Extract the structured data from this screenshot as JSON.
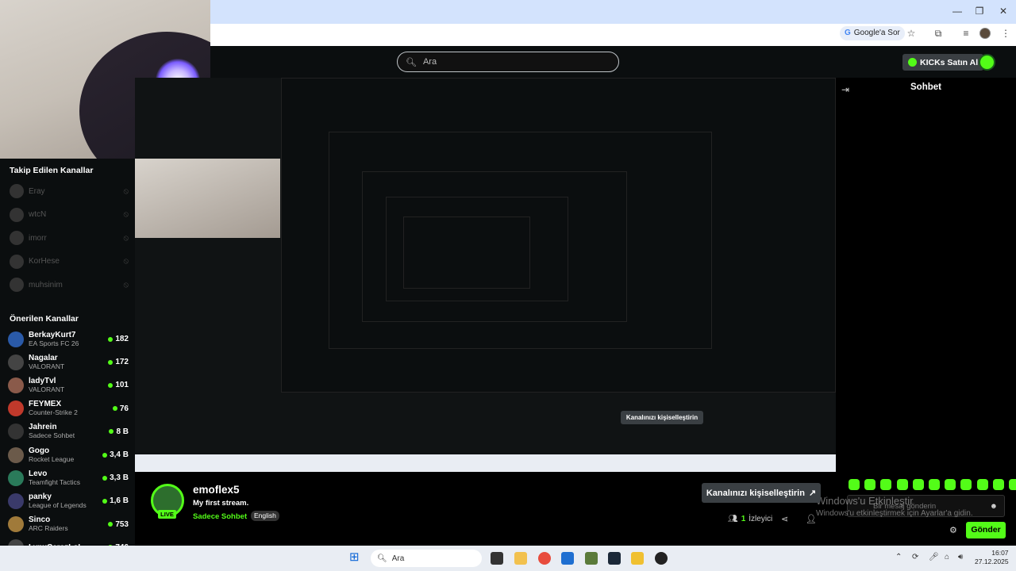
{
  "browser": {
    "ask_google_label": "Google'a Sor",
    "icons": [
      "minimize-icon",
      "restore-icon",
      "close-icon",
      "star-icon",
      "extensions-icon",
      "queue-icon",
      "menu-icon"
    ]
  },
  "kick": {
    "search_placeholder": "Ara",
    "buy_kicks_label": "KICKs Satın Al"
  },
  "sidebar": {
    "followed_title": "Takip Edilen Kanallar",
    "followed": [
      {
        "name": "Eray"
      },
      {
        "name": "wtcN"
      },
      {
        "name": "imorr"
      },
      {
        "name": "KorHese"
      },
      {
        "name": "muhsinim"
      }
    ],
    "recommended_title": "Önerilen Kanallar",
    "recommended": [
      {
        "name": "BerkayKurt7",
        "category": "EA Sports FC 26",
        "viewers": "182",
        "color": "#2a5aa8"
      },
      {
        "name": "Nagalar",
        "category": "VALORANT",
        "viewers": "172",
        "color": "#444"
      },
      {
        "name": "ladyTvl",
        "category": "VALORANT",
        "viewers": "101",
        "color": "#8a5a4a"
      },
      {
        "name": "FEYMEX",
        "category": "Counter-Strike 2",
        "viewers": "76",
        "color": "#c0392b"
      },
      {
        "name": "Jahrein",
        "category": "Sadece Sohbet",
        "viewers": "8 B",
        "color": "#333"
      },
      {
        "name": "Gogo",
        "category": "Rocket League",
        "viewers": "3,4 B",
        "color": "#6b5a4a"
      },
      {
        "name": "Levo",
        "category": "Teamfight Tactics",
        "viewers": "3,3 B",
        "color": "#2a7a5a"
      },
      {
        "name": "panky",
        "category": "League of Legends",
        "viewers": "1,6 B",
        "color": "#3a3a6a"
      },
      {
        "name": "Sinco",
        "category": "ARC Raiders",
        "viewers": "753",
        "color": "#a07a3a"
      },
      {
        "name": "LynxCerezLoL",
        "category": "",
        "viewers": "746",
        "color": "#444"
      }
    ]
  },
  "stream": {
    "streamer": "emoflex5",
    "title": "My first stream.",
    "category": "Sadece Sohbet",
    "language": "English",
    "live_label": "LIVE",
    "customize_label": "Kanalınızı kişiselleştirin",
    "viewers_count": "1",
    "viewers_label": "İzleyici"
  },
  "chat": {
    "title": "Sohbet",
    "placeholder": "Bir mesaj gönderin",
    "send_label": "Gönder"
  },
  "watermark": {
    "line1": "Windows'u Etkinleştir",
    "line2": "Windows'u etkinleştirmek için Ayarlar'a gidin."
  },
  "taskbar": {
    "search_placeholder": "Ara",
    "time": "16:07",
    "date": "27.12.2025"
  }
}
